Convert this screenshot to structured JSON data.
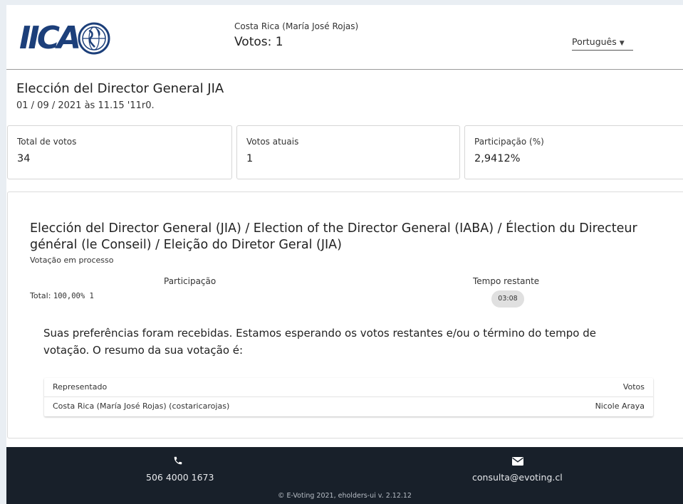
{
  "header": {
    "logo_text": "IICA",
    "delegation": "Costa Rica (María José Rojas)",
    "votes": "Votos: 1",
    "language": "Português"
  },
  "election": {
    "title": "Elección del Director General JIA",
    "date": "01 / 09 / 2021 às 11.15 '11r0."
  },
  "stats": [
    {
      "label": "Total de votos",
      "value": "34"
    },
    {
      "label": "Votos atuais",
      "value": "1"
    },
    {
      "label": "Participação (%)",
      "value": "2,9412%"
    }
  ],
  "question": {
    "title": "Elección del Director General (JIA) / Election of the Director General (IABA) / Élection du Directeur général (le Conseil) / Eleição do Diretor Geral (JIA)",
    "status": "Votação em processo",
    "participation_label": "Participação",
    "total_label": "Total:",
    "total_value": "100,00% 1",
    "time_label": "Tempo restante",
    "time_value": "03:08",
    "message": "Suas preferências foram recebidas. Estamos esperando os votos restantes e/ou o término do tempo de votação. O resumo da sua votação é:"
  },
  "summary_table": {
    "headers": [
      "Representado",
      "Votos"
    ],
    "rows": [
      [
        "Costa Rica (María José Rojas) (costaricarojas)",
        "Nicole Araya"
      ]
    ]
  },
  "footer": {
    "phone": "506 4000 1673",
    "email": "consulta@evoting.cl",
    "copyright": "© E-Voting 2021, eholders-ui v. 2.12.12"
  },
  "icons": {
    "phone": "phone-icon",
    "mail": "mail-icon",
    "globe": "globe-icon",
    "caret": "caret-down-icon"
  },
  "colors": {
    "brand": "#1c3f7a",
    "footer_bg": "#18202a",
    "page_bg": "#e9eef3"
  }
}
